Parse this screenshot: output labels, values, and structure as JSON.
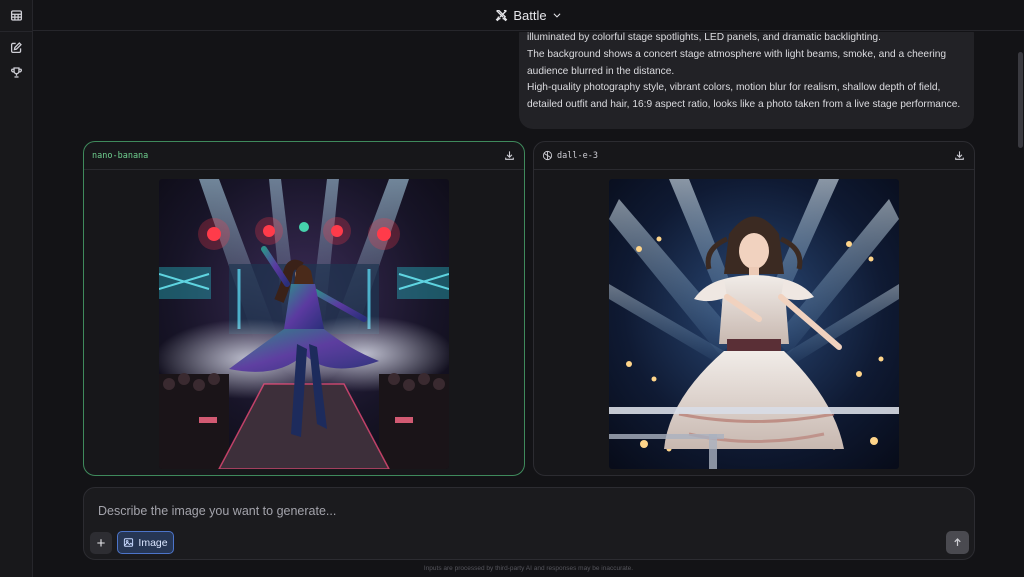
{
  "header": {
    "title": "Battle",
    "title_icon": "battle-swords-icon",
    "dropdown_icon": "chevron-down-icon"
  },
  "sidebar": {
    "items": [
      {
        "icon": "table-icon"
      },
      {
        "icon": "edit-icon"
      },
      {
        "icon": "trophy-icon"
      }
    ]
  },
  "prompt": {
    "lines": [
      "illuminated by colorful stage spotlights, LED panels, and dramatic backlighting.",
      "The background shows a concert stage atmosphere with light beams, smoke, and a cheering audience blurred in the distance.",
      "High-quality photography style, vibrant colors, motion blur for realism, shallow depth of field, detailed outfit and hair, 16:9 aspect ratio, looks like a photo taken from a live stage performance."
    ]
  },
  "results": [
    {
      "model": "nano-banana",
      "winner": true,
      "download_icon": "download-icon"
    },
    {
      "model": "dall-e-3",
      "model_icon": "openai-icon",
      "winner": false,
      "download_icon": "download-icon"
    }
  ],
  "composer": {
    "placeholder": "Describe the image you want to generate...",
    "plus_label": "+",
    "image_chip_label": "Image",
    "send_icon": "arrow-up-icon"
  },
  "footer": {
    "disclaimer": "Inputs are processed by third-party AI and responses may be inaccurate."
  },
  "colors": {
    "background": "#131316",
    "winner_border": "#3f8a5c",
    "winner_text": "#6fcf8f",
    "chip_accent": "#4c74c9"
  }
}
